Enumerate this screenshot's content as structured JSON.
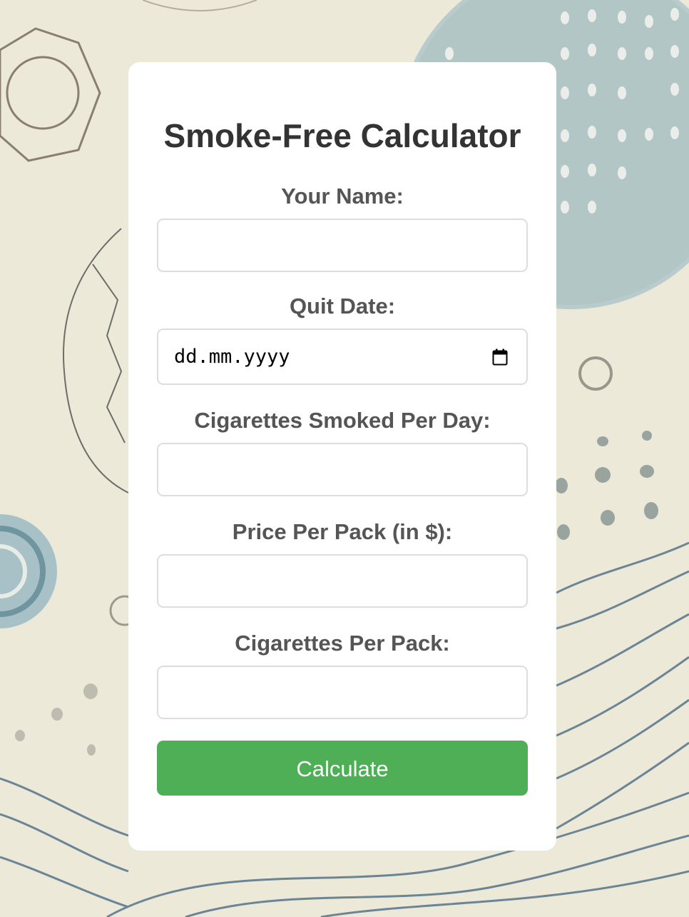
{
  "form": {
    "title": "Smoke-Free Calculator",
    "fields": [
      {
        "label": "Your Name:",
        "value": "",
        "placeholder": ""
      },
      {
        "label": "Quit Date:",
        "value": "dd.mm.yyyy"
      },
      {
        "label": "Cigarettes Smoked Per Day:",
        "value": "",
        "placeholder": ""
      },
      {
        "label": "Price Per Pack (in $):",
        "value": "",
        "placeholder": ""
      },
      {
        "label": "Cigarettes Per Pack:",
        "value": "",
        "placeholder": ""
      }
    ],
    "submit_label": "Calculate"
  },
  "colors": {
    "accent": "#4faf56",
    "card": "#ffffff",
    "title": "#333333",
    "label": "#555555",
    "input_border": "#dddddd"
  },
  "icons": {
    "date_picker": "calendar-icon"
  }
}
